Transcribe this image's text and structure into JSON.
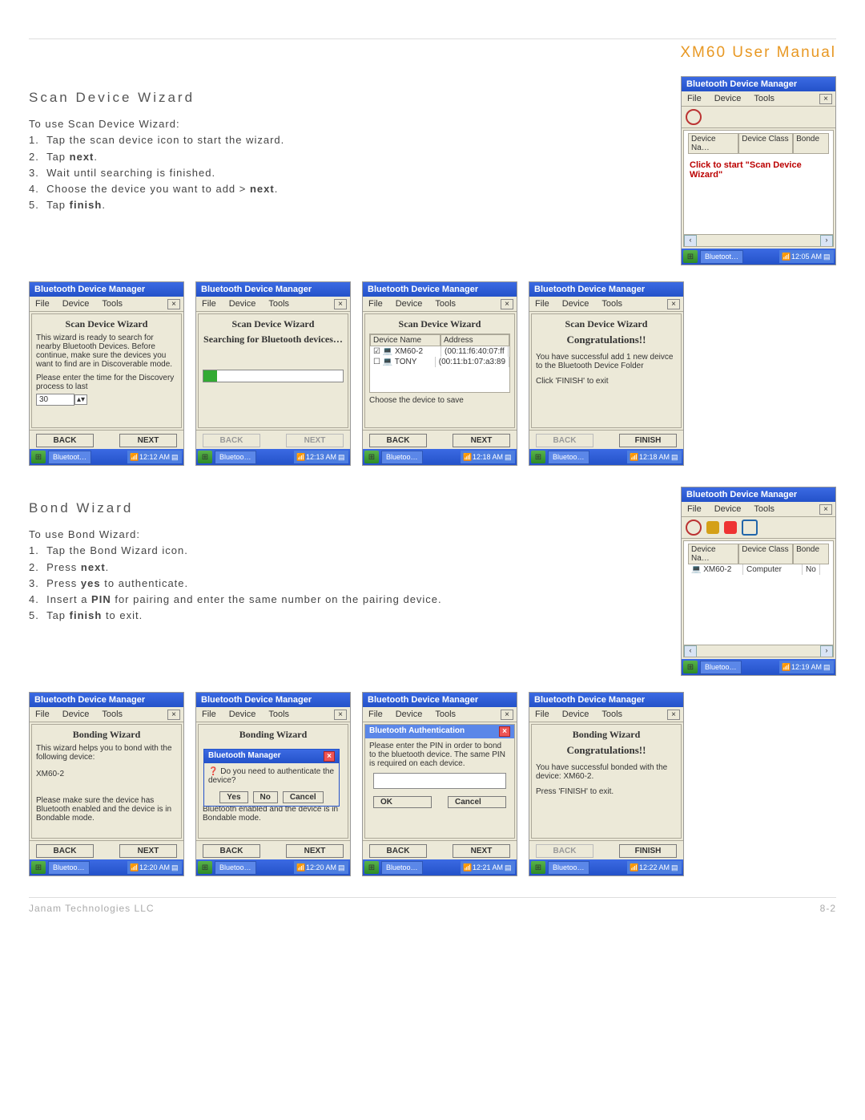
{
  "header": {
    "title": "XM60 User Manual"
  },
  "scan": {
    "title": "Scan Device Wizard",
    "intro": "To use Scan Device Wizard:",
    "steps": [
      "Tap the scan device icon to start the wizard.",
      {
        "pre": "Tap ",
        "b": "next",
        "post": "."
      },
      "Wait until searching is finished.",
      {
        "pre": "Choose the device you want to add > ",
        "b": "next",
        "post": "."
      },
      {
        "pre": "Tap ",
        "b": "finish",
        "post": "."
      }
    ],
    "bt_manager": "Bluetooth Device Manager",
    "menu": {
      "file": "File",
      "device": "Device",
      "tools": "Tools",
      "close": "×"
    },
    "s0": {
      "dev_head": "Device Na…",
      "class_head": "Device Class",
      "bond_head": "Bonde",
      "red": "Click to start \"Scan Device Wizard\"",
      "task": "Bluetoot…",
      "time": "12:05 AM"
    },
    "s1": {
      "h": "Scan Device Wizard",
      "body": "This wizard is ready to search for nearby Bluetooth Devices. Before continue, make sure the devices you want to find are in Discoverable mode.",
      "plabel": "Please enter the time for the Discovery process to last",
      "val": "30",
      "back": "BACK",
      "next": "NEXT",
      "task": "Bluetoot…",
      "time": "12:12 AM"
    },
    "s2": {
      "h": "Scan Device Wizard",
      "sub": "Searching for Bluetooth devices…",
      "back": "BACK",
      "next": "NEXT",
      "task": "Bluetoo…",
      "time": "12:13 AM"
    },
    "s3": {
      "h": "Scan Device Wizard",
      "chead1": "Device Name",
      "chead2": "Address",
      "d1": "XM60-2",
      "a1": "(00:11:f6:40:07:ff",
      "d2": "TONY",
      "a2": "(00:11:b1:07:a3:89",
      "choose": "Choose the device to save",
      "back": "BACK",
      "next": "NEXT",
      "task": "Bluetoo…",
      "time": "12:18 AM"
    },
    "s4": {
      "h": "Scan Device Wizard",
      "cong": "Congratulations!!",
      "body": "You have successful add 1 new deivce to the Bluetooth Device Folder",
      "exit": "Click 'FINISH' to exit",
      "back": "BACK",
      "finish": "FINISH",
      "task": "Bluetoo…",
      "time": "12:18 AM"
    }
  },
  "bond": {
    "title": "Bond Wizard",
    "intro": "To use Bond Wizard:",
    "steps": [
      "Tap the Bond Wizard icon.",
      {
        "pre": "Press ",
        "b": "next",
        "post": "."
      },
      {
        "pre": "Press ",
        "b": "yes",
        "post": " to authenticate."
      },
      {
        "pre": "Insert a ",
        "b": "PIN",
        "post": " for pairing and enter the same number on the pairing device."
      },
      {
        "pre": "Tap ",
        "b": "finish",
        "post": " to exit."
      }
    ],
    "b0": {
      "dev_head": "Device Na…",
      "class_head": "Device Class",
      "bond_head": "Bonde",
      "d1": "XM60-2",
      "c1": "Computer",
      "bn": "No",
      "task": "Bluetoo…",
      "time": "12:19 AM"
    },
    "b1": {
      "h": "Bonding Wizard",
      "body": "This wizard helps you to bond with the following device:",
      "dev": "XM60-2",
      "note": "Please make sure the device has Bluetooth enabled and the device is in Bondable mode.",
      "back": "BACK",
      "next": "NEXT",
      "task": "Bluetoo…",
      "time": "12:20 AM"
    },
    "b2": {
      "h": "Bonding Wizard",
      "dlg_title": "Bluetooth Manager",
      "dlg_body": "Do you need to authenticate the device?",
      "yes": "Yes",
      "no": "No",
      "cancel": "Cancel",
      "note": "Bluetooth enabled and the device is in Bondable mode.",
      "back": "BACK",
      "next": "NEXT",
      "task": "Bluetoo…",
      "time": "12:20 AM"
    },
    "b3": {
      "auth": "Bluetooth Authentication",
      "body": "Please enter the PIN in order to bond to the bluetooth device. The same PIN is required on each device.",
      "ok": "OK",
      "cancel": "Cancel",
      "back": "BACK",
      "next": "NEXT",
      "task": "Bluetoo…",
      "time": "12:21 AM"
    },
    "b4": {
      "h": "Bonding Wizard",
      "cong": "Congratulations!!",
      "body": "You have successful bonded with the device: XM60-2.",
      "exit": "Press 'FINISH' to exit.",
      "back": "BACK",
      "finish": "FINISH",
      "task": "Bluetoo…",
      "time": "12:22 AM"
    }
  },
  "footer": {
    "company": "Janam Technologies LLC",
    "page": "8-2"
  }
}
